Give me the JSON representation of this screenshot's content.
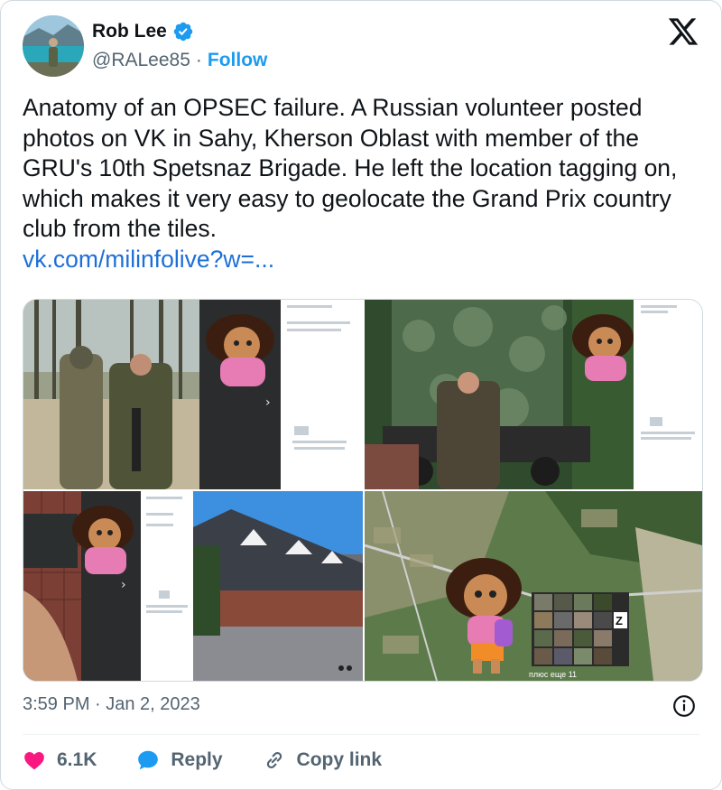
{
  "author": {
    "display_name": "Rob Lee",
    "handle": "@RALee85",
    "separator": "·",
    "follow_label": "Follow"
  },
  "tweet": {
    "text": "Anatomy of an OPSEC failure. A Russian volunteer posted photos on VK in Sahy, Kherson Oblast with member of the GRU's 10th Spetsnaz Brigade. He left the location tagging on, which makes it very easy to geolocate the Grand Prix country club from the tiles.",
    "link": "vk.com/milinfolive?w=...",
    "time": "3:59 PM · Jan 2, 2023"
  },
  "media_overlay": {
    "map_caption": "плюс еще 11",
    "tile_letter": "Z"
  },
  "actions": {
    "likes": "6.1K",
    "reply_label": "Reply",
    "copy_label": "Copy link"
  },
  "colors": {
    "accent": "#1d9bf0",
    "like": "#f91880",
    "text": "#0f1419",
    "muted": "#536471"
  }
}
